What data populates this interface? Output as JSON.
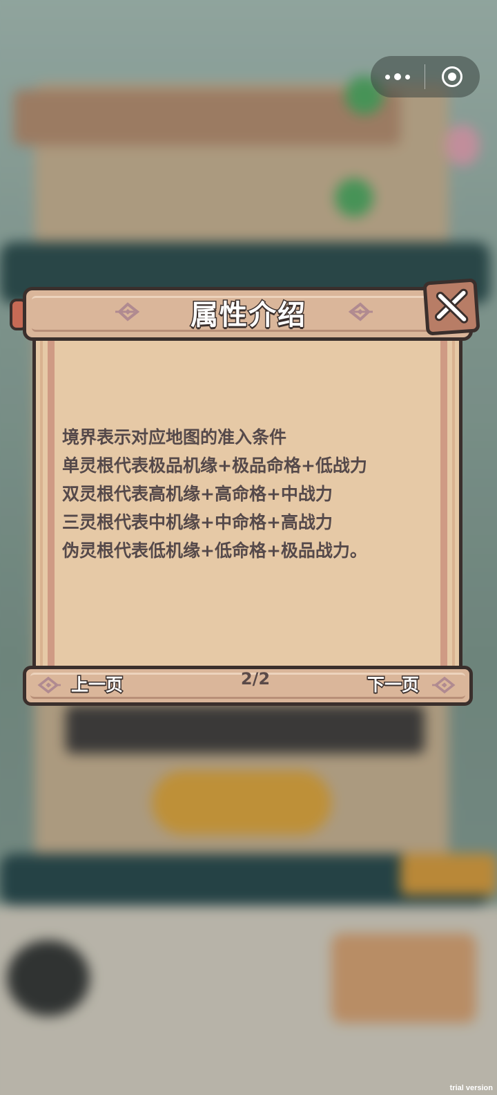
{
  "capsule": {
    "more_icon": "more-dots-icon",
    "close_icon": "target-circle-icon"
  },
  "dialog": {
    "title": "属性介绍",
    "lines": [
      "境界表示对应地图的准入条件",
      "单灵根代表极品机缘+极品命格+低战力",
      "双灵根代表高机缘+高命格+中战力",
      "三灵根代表中机缘+中命格+高战力",
      "伪灵根代表低机缘+低命格+极品战力。"
    ],
    "prev_label": "上一页",
    "next_label": "下一页",
    "page_indicator": "2/2",
    "close_icon": "close-x-icon"
  },
  "watermark": "trial version",
  "colors": {
    "paper": "#e6c9a6",
    "scroll_roll": "#dab69a",
    "outline": "#3a2f2c",
    "text": "#55494a"
  }
}
